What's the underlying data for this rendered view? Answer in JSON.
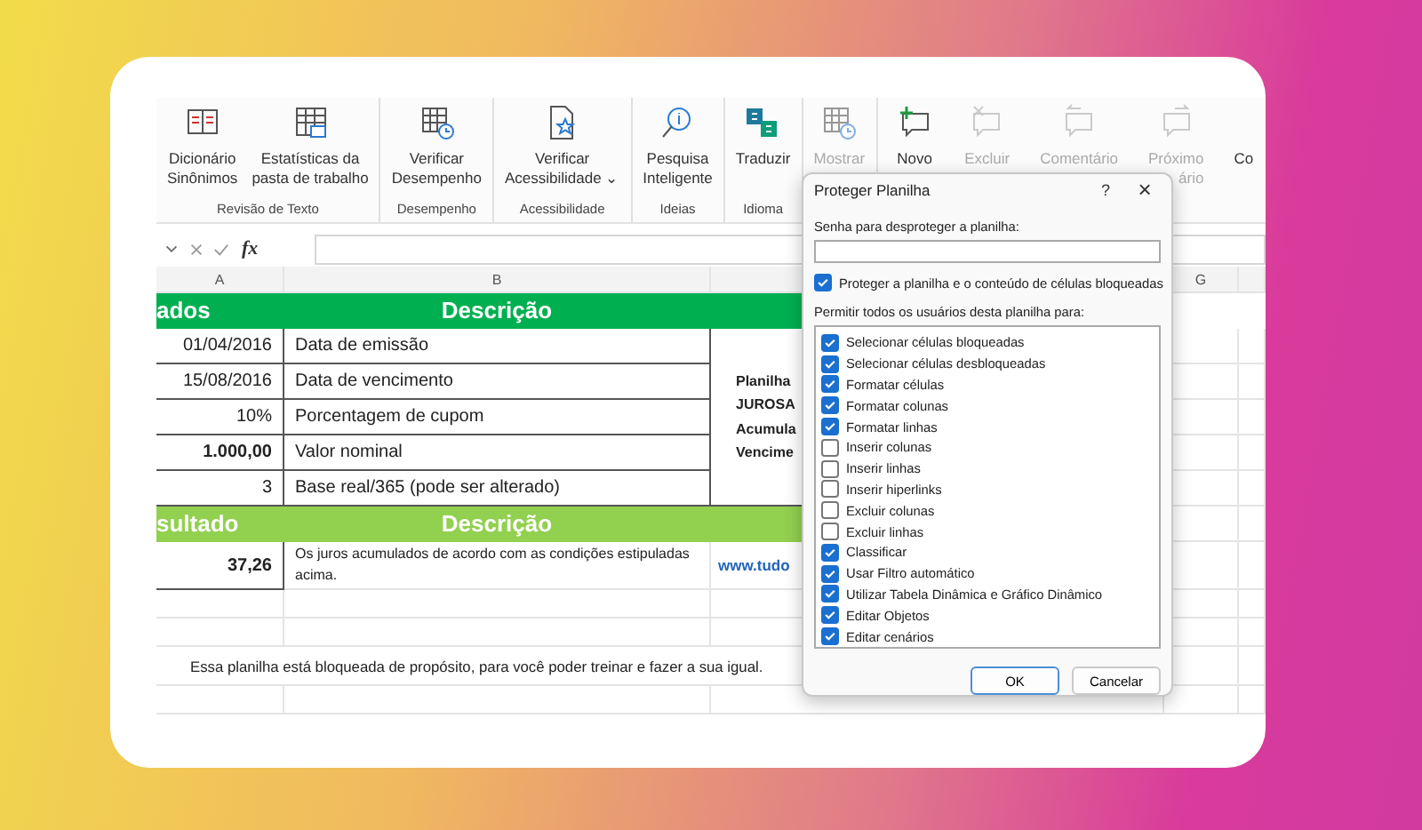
{
  "ribbon": {
    "groups": [
      {
        "label": "Revisão de Texto",
        "buttons": [
          {
            "lines": [
              "Dicionário",
              "Sinônimos"
            ],
            "disabled": false
          },
          {
            "lines": [
              "Estatísticas da",
              "pasta de trabalho"
            ],
            "disabled": false
          }
        ]
      },
      {
        "label": "Desempenho",
        "buttons": [
          {
            "lines": [
              "Verificar",
              "Desempenho"
            ],
            "disabled": false
          }
        ]
      },
      {
        "label": "Acessibilidade",
        "buttons": [
          {
            "lines": [
              "Verificar",
              "Acessibilidade ⌄"
            ],
            "disabled": false
          }
        ]
      },
      {
        "label": "Ideias",
        "buttons": [
          {
            "lines": [
              "Pesquisa",
              "Inteligente"
            ],
            "disabled": false
          }
        ]
      },
      {
        "label": "Idioma",
        "buttons": [
          {
            "lines": [
              "Traduzir"
            ],
            "disabled": false
          }
        ]
      },
      {
        "buttons": [
          {
            "lines": [
              "Mostrar"
            ],
            "disabled": true
          }
        ]
      },
      {
        "buttons": [
          {
            "lines": [
              "Novo"
            ],
            "disabled": false
          },
          {
            "lines": [
              "Excluir"
            ],
            "disabled": true
          },
          {
            "lines": [
              "Comentário"
            ],
            "disabled": true
          },
          {
            "lines": [
              "Próximo",
              "ário"
            ],
            "disabled": true
          },
          {
            "lines": [
              "Co"
            ],
            "disabled": false
          }
        ]
      }
    ]
  },
  "formula_bar": {
    "fx": "fx"
  },
  "sheet": {
    "column_headers": [
      "A",
      "B",
      "G"
    ],
    "header_row": [
      "ados",
      "Descrição"
    ],
    "rows": [
      {
        "value": "01/04/2016",
        "description": "Data de emissão",
        "bold": false
      },
      {
        "value": "15/08/2016",
        "description": "Data de vencimento",
        "bold": false
      },
      {
        "value": "10%",
        "description": "Porcentagem de cupom",
        "bold": false
      },
      {
        "value": "1.000,00",
        "description": "Valor nominal",
        "bold": true
      },
      {
        "value": "3",
        "description": "Base real/365 (pode ser alterado)",
        "bold": false
      }
    ],
    "side_note": [
      "Planilha",
      "JUROSA",
      "Acumula",
      "Vencime"
    ],
    "result_header": [
      "sultado",
      "Descrição"
    ],
    "result": {
      "value": "37,26",
      "description": "Os juros acumulados de acordo com as condições estipuladas acima.",
      "link": "www.tudo"
    },
    "note": "Essa planilha está bloqueada de propósito, para você poder treinar e fazer a sua igual."
  },
  "dialog": {
    "title": "Proteger Planilha",
    "help": "?",
    "close": "×",
    "password_label": "Senha para desproteger a planilha:",
    "protect": {
      "label": "Proteger a planilha e o conteúdo de células bloqueadas",
      "checked": true
    },
    "allow_label": "Permitir todos os usuários desta planilha para:",
    "permissions": [
      {
        "label": "Selecionar células bloqueadas",
        "checked": true
      },
      {
        "label": "Selecionar células desbloqueadas",
        "checked": true
      },
      {
        "label": "Formatar células",
        "checked": true
      },
      {
        "label": "Formatar colunas",
        "checked": true
      },
      {
        "label": "Formatar linhas",
        "checked": true
      },
      {
        "label": "Inserir colunas",
        "checked": false
      },
      {
        "label": "Inserir linhas",
        "checked": false
      },
      {
        "label": "Inserir hiperlinks",
        "checked": false
      },
      {
        "label": "Excluir colunas",
        "checked": false
      },
      {
        "label": "Excluir linhas",
        "checked": false
      },
      {
        "label": "Classificar",
        "checked": true
      },
      {
        "label": "Usar Filtro automático",
        "checked": true
      },
      {
        "label": "Utilizar Tabela Dinâmica e Gráfico Dinâmico",
        "checked": true
      },
      {
        "label": "Editar Objetos",
        "checked": true
      },
      {
        "label": "Editar cenários",
        "checked": true
      }
    ],
    "buttons": [
      "OK",
      "Cancelar"
    ]
  }
}
